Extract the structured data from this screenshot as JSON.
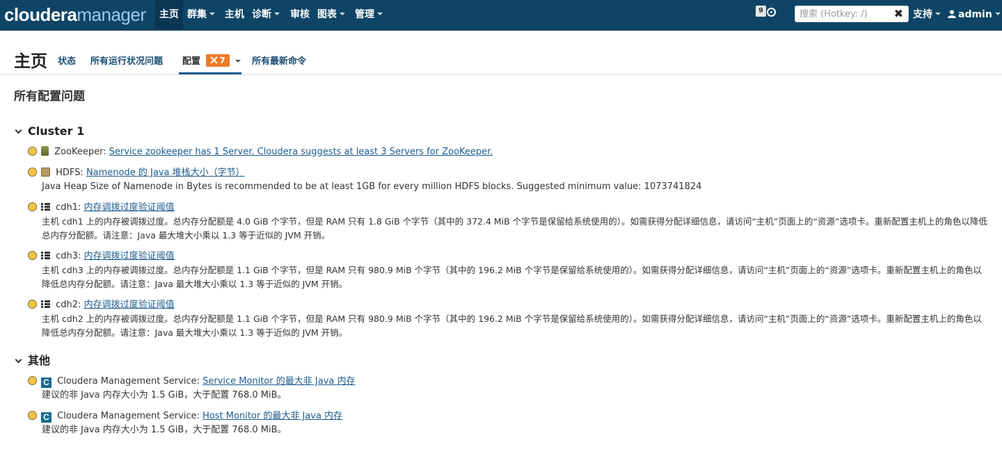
{
  "nav": {
    "brand_cloudera": "cloudera",
    "brand_manager": "manager",
    "items": [
      {
        "label": "主页",
        "active": true,
        "dropdown": false
      },
      {
        "label": "群集",
        "dropdown": true
      },
      {
        "label": "主机",
        "dropdown": false
      },
      {
        "label": "诊断",
        "dropdown": true
      },
      {
        "label": "审核",
        "dropdown": false
      },
      {
        "label": "图表",
        "dropdown": true
      },
      {
        "label": "管理",
        "dropdown": true
      }
    ],
    "notification_count": "9",
    "search_placeholder": "搜索 (Hotkey: /)",
    "clear_glyph": "✖",
    "support_label": "支持",
    "user_label": "admin"
  },
  "page": {
    "title": "主页",
    "tabs": [
      {
        "label": "状态"
      },
      {
        "label": "所有运行状况问题"
      },
      {
        "label": "配置",
        "badge": "7",
        "badge_icon": "wrench-cross-icon",
        "active": true
      },
      {
        "label": "所有最新命令"
      }
    ],
    "section_title": "所有配置问题"
  },
  "groups": [
    {
      "title": "Cluster 1",
      "issues": [
        {
          "source": "ZooKeeper:",
          "icon": "zookeeper-icon",
          "link": "Service zookeeper has 1 Server. Cloudera suggests at least 3 Servers for ZooKeeper.",
          "desc": ""
        },
        {
          "source": "HDFS:",
          "icon": "hdfs-icon",
          "link": "Namenode 的 Java 堆栈大小（字节）",
          "desc": "Java Heap Size of Namenode in Bytes is recommended to be at least 1GB for every million HDFS blocks. Suggested minimum value: 1073741824"
        },
        {
          "source": "cdh1:",
          "icon": "host-icon",
          "link": "内存调拨过度验证阈值",
          "desc": "主机 cdh1 上的内存被调拨过度。总内存分配额是 4.0 GiB 个字节，但是 RAM 只有 1.8 GiB 个字节（其中的 372.4 MiB 个字节是保留给系统使用的）。如需获得分配详细信息，请访问“主机”页面上的“资源”选项卡。重新配置主机上的角色以降低总内存分配额。请注意：Java 最大堆大小乘以 1.3 等于近似的 JVM 开销。"
        },
        {
          "source": "cdh3:",
          "icon": "host-icon",
          "link": "内存调拨过度验证阈值",
          "desc": "主机 cdh3 上的内存被调拨过度。总内存分配额是 1.1 GiB 个字节，但是 RAM 只有 980.9 MiB 个字节（其中的 196.2 MiB 个字节是保留给系统使用的）。如需获得分配详细信息，请访问“主机”页面上的“资源”选项卡。重新配置主机上的角色以降低总内存分配额。请注意：Java 最大堆大小乘以 1.3 等于近似的 JVM 开销。"
        },
        {
          "source": "cdh2:",
          "icon": "host-icon",
          "link": "内存调拨过度验证阈值",
          "desc": "主机 cdh2 上的内存被调拨过度。总内存分配额是 1.1 GiB 个字节，但是 RAM 只有 980.9 MiB 个字节（其中的 196.2 MiB 个字节是保留给系统使用的）。如需获得分配详细信息，请访问“主机”页面上的“资源”选项卡。重新配置主机上的角色以降低总内存分配额。请注意：Java 最大堆大小乘以 1.3 等于近似的 JVM 开销。"
        }
      ]
    },
    {
      "title": "其他",
      "issues": [
        {
          "source": "Cloudera Management Service:",
          "icon": "cloudera-management-icon",
          "link": "Service Monitor 的最大非 Java 内存",
          "desc": "建议的非 Java 内存大小为 1.5 GiB，大于配置 768.0 MiB。"
        },
        {
          "source": "Cloudera Management Service:",
          "icon": "cloudera-management-icon",
          "link": "Host Monitor 的最大非 Java 内存",
          "desc": "建议的非 Java 内存大小为 1.5 GiB，大于配置 768.0 MiB。"
        }
      ]
    }
  ]
}
